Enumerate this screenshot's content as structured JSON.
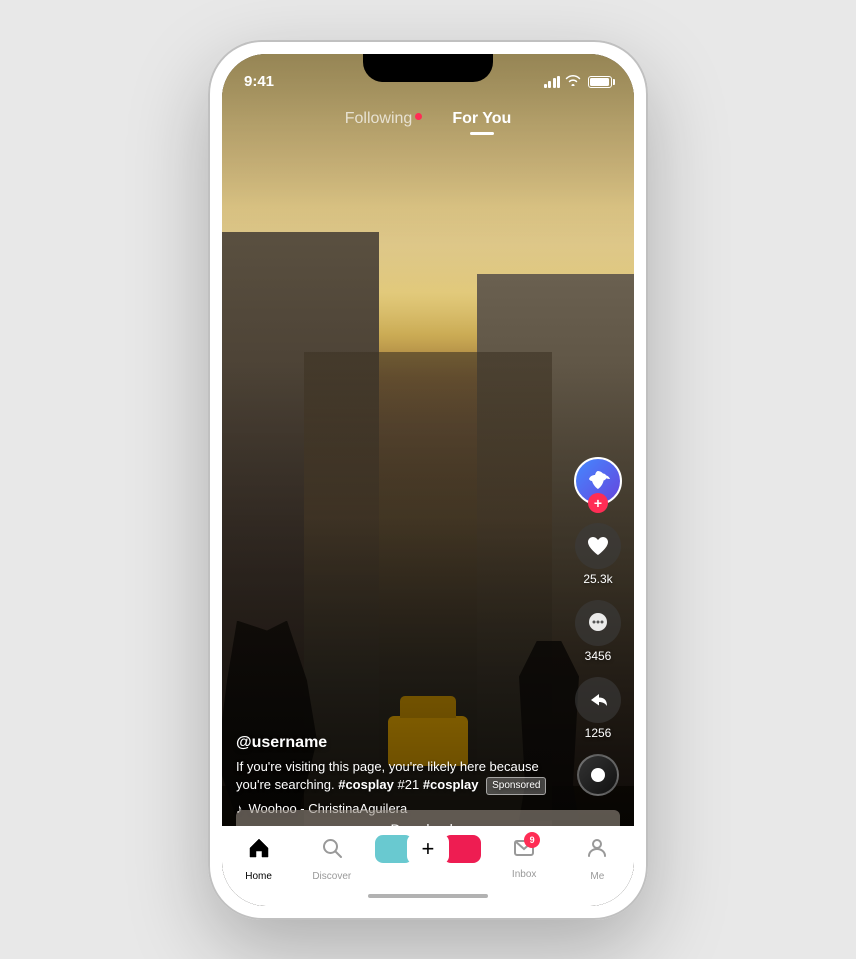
{
  "status_bar": {
    "time": "9:41",
    "signal_bars": 4,
    "wifi": true,
    "battery_pct": 85
  },
  "top_nav": {
    "following_label": "Following",
    "for_you_label": "For You",
    "active_tab": "for_you",
    "has_notification_dot": true
  },
  "actions": {
    "likes_count": "25.3k",
    "comments_count": "3456",
    "shares_count": "1256",
    "avatar_tiktok_logo": "♪"
  },
  "content": {
    "username": "@username",
    "description_start": "If you're visiting this page, you're likely here because you're searching. ",
    "hashtag1": "#cosplay",
    "hashtag2": "#21",
    "hashtag3": "#cosplay",
    "sponsored_label": "Sponsored",
    "music_note": "♪",
    "music_info": "Woohoo - ChristinaAguilera"
  },
  "download_bar": {
    "label": "Download",
    "arrow": "›"
  },
  "bottom_nav": {
    "home_label": "Home",
    "discover_label": "Discover",
    "inbox_label": "Inbox",
    "me_label": "Me",
    "inbox_badge": "9",
    "plus_label": "+"
  }
}
